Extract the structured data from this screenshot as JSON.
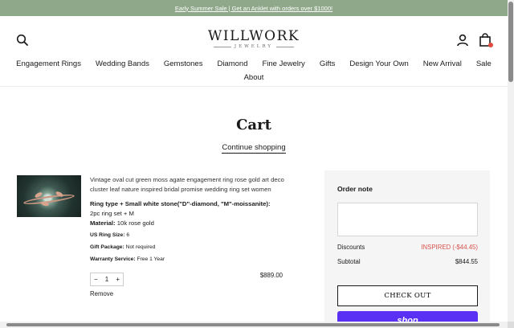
{
  "announcement": {
    "text": "Early Summer Sale | Get an Anklet with orders over $1000!"
  },
  "header": {
    "logo_main": "WILLWORK",
    "logo_sub": "JEWELRY",
    "icons": {
      "search": "search-icon",
      "account": "user-icon",
      "cart": "shopping-bag-icon"
    },
    "cart_badge_color": "#e04a3f"
  },
  "nav": {
    "row1": [
      "Engagement Rings",
      "Wedding Bands",
      "Gemstones",
      "Diamond",
      "Fine Jewelry",
      "Gifts",
      "Design Your Own",
      "New Arrival",
      "Sale"
    ],
    "row2": [
      "About"
    ]
  },
  "cart": {
    "title": "Cart",
    "continue_label": "Continue shopping"
  },
  "item": {
    "name": "Vintage oval cut green moss agate engagement ring rose gold art deco cluster leaf nature inspired bridal promise wedding ring set women",
    "ring_type_label": "Ring type + Small white stone(\"D\"-diamond, \"M\"-moissanite):",
    "ring_type_value": "2pc ring set + M",
    "material_label": "Material:",
    "material_value": "10k rose gold",
    "size_label": "US Ring Size:",
    "size_value": "6",
    "gift_label": "Gift Package:",
    "gift_value": "Not required",
    "warranty_label": "Warranty Service:",
    "warranty_value": "Free 1 Year",
    "qty_minus": "−",
    "quantity": "1",
    "qty_plus": "+",
    "price": "$889.00",
    "remove_label": "Remove"
  },
  "summary": {
    "order_note_label": "Order note",
    "note_value": "",
    "discounts_label": "Discounts",
    "discounts_value": "INSPIRED (-$44.45)",
    "subtotal_label": "Subtotal",
    "subtotal_value": "$844.55",
    "checkout_label": "CHECK OUT",
    "shop_pay_label": "shop",
    "accent_color": "#5a31f4",
    "discount_color": "#d9534f"
  }
}
